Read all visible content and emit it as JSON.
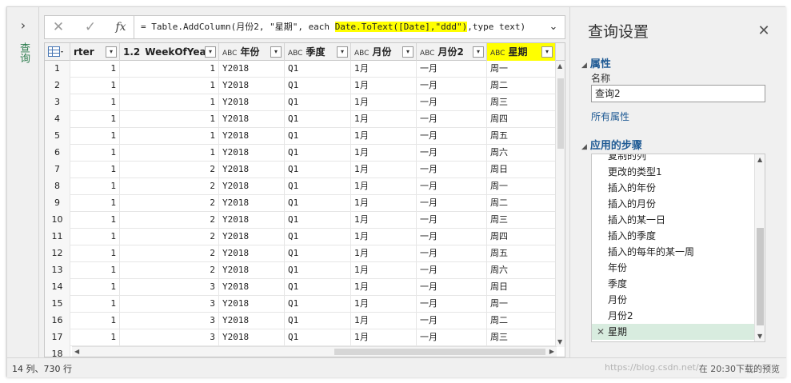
{
  "left_strip": {
    "expand_icon": "›",
    "title": "查询"
  },
  "formula": {
    "cancel_icon": "✕",
    "confirm_icon": "✓",
    "fx_label": "fx",
    "prefix": "= Table.AddColumn(月份2, \"星期\", each ",
    "highlight": "Date.ToText([Date],\"ddd\")",
    "suffix": ",type text)",
    "expand_icon": "⌄"
  },
  "grid": {
    "headers": {
      "quarter": "rter",
      "week_type": "1.2",
      "week": "WeekOfYear",
      "abc": "ABC",
      "year": "年份",
      "season": "季度",
      "month": "月份",
      "month2": "月份2",
      "weekday": "星期"
    },
    "rows": [
      {
        "i": "1",
        "q": "1",
        "w": "1",
        "y": "Y2018",
        "s": "Q1",
        "m": "1月",
        "m2": "一月",
        "d": "周一"
      },
      {
        "i": "2",
        "q": "1",
        "w": "1",
        "y": "Y2018",
        "s": "Q1",
        "m": "1月",
        "m2": "一月",
        "d": "周二"
      },
      {
        "i": "3",
        "q": "1",
        "w": "1",
        "y": "Y2018",
        "s": "Q1",
        "m": "1月",
        "m2": "一月",
        "d": "周三"
      },
      {
        "i": "4",
        "q": "1",
        "w": "1",
        "y": "Y2018",
        "s": "Q1",
        "m": "1月",
        "m2": "一月",
        "d": "周四"
      },
      {
        "i": "5",
        "q": "1",
        "w": "1",
        "y": "Y2018",
        "s": "Q1",
        "m": "1月",
        "m2": "一月",
        "d": "周五"
      },
      {
        "i": "6",
        "q": "1",
        "w": "1",
        "y": "Y2018",
        "s": "Q1",
        "m": "1月",
        "m2": "一月",
        "d": "周六"
      },
      {
        "i": "7",
        "q": "1",
        "w": "2",
        "y": "Y2018",
        "s": "Q1",
        "m": "1月",
        "m2": "一月",
        "d": "周日"
      },
      {
        "i": "8",
        "q": "1",
        "w": "2",
        "y": "Y2018",
        "s": "Q1",
        "m": "1月",
        "m2": "一月",
        "d": "周一"
      },
      {
        "i": "9",
        "q": "1",
        "w": "2",
        "y": "Y2018",
        "s": "Q1",
        "m": "1月",
        "m2": "一月",
        "d": "周二"
      },
      {
        "i": "10",
        "q": "1",
        "w": "2",
        "y": "Y2018",
        "s": "Q1",
        "m": "1月",
        "m2": "一月",
        "d": "周三"
      },
      {
        "i": "11",
        "q": "1",
        "w": "2",
        "y": "Y2018",
        "s": "Q1",
        "m": "1月",
        "m2": "一月",
        "d": "周四"
      },
      {
        "i": "12",
        "q": "1",
        "w": "2",
        "y": "Y2018",
        "s": "Q1",
        "m": "1月",
        "m2": "一月",
        "d": "周五"
      },
      {
        "i": "13",
        "q": "1",
        "w": "2",
        "y": "Y2018",
        "s": "Q1",
        "m": "1月",
        "m2": "一月",
        "d": "周六"
      },
      {
        "i": "14",
        "q": "1",
        "w": "3",
        "y": "Y2018",
        "s": "Q1",
        "m": "1月",
        "m2": "一月",
        "d": "周日"
      },
      {
        "i": "15",
        "q": "1",
        "w": "3",
        "y": "Y2018",
        "s": "Q1",
        "m": "1月",
        "m2": "一月",
        "d": "周一"
      },
      {
        "i": "16",
        "q": "1",
        "w": "3",
        "y": "Y2018",
        "s": "Q1",
        "m": "1月",
        "m2": "一月",
        "d": "周二"
      },
      {
        "i": "17",
        "q": "1",
        "w": "3",
        "y": "Y2018",
        "s": "Q1",
        "m": "1月",
        "m2": "一月",
        "d": "周三"
      },
      {
        "i": "18",
        "q": "",
        "w": "",
        "y": "",
        "s": "",
        "m": "",
        "m2": "",
        "d": ""
      }
    ]
  },
  "query_settings": {
    "title": "查询设置",
    "close_icon": "✕",
    "properties_header": "属性",
    "name_label": "名称",
    "name_value": "查询2",
    "all_properties_link": "所有属性",
    "applied_steps_header": "应用的步骤",
    "steps": [
      "复制的列",
      "更改的类型1",
      "插入的年份",
      "插入的月份",
      "插入的某一日",
      "插入的季度",
      "插入的每年的某一周",
      "年份",
      "季度",
      "月份",
      "月份2",
      "星期"
    ],
    "selected_step_icon": "✕"
  },
  "status_bar": {
    "left": "14 列、730 行",
    "right": "在 20:30下载的预览"
  },
  "watermark": "https://blog.csdn.net/",
  "colors": {
    "highlight": "#ffff00",
    "accent": "#1f5a94",
    "selected_step": "#d8ecdf"
  }
}
